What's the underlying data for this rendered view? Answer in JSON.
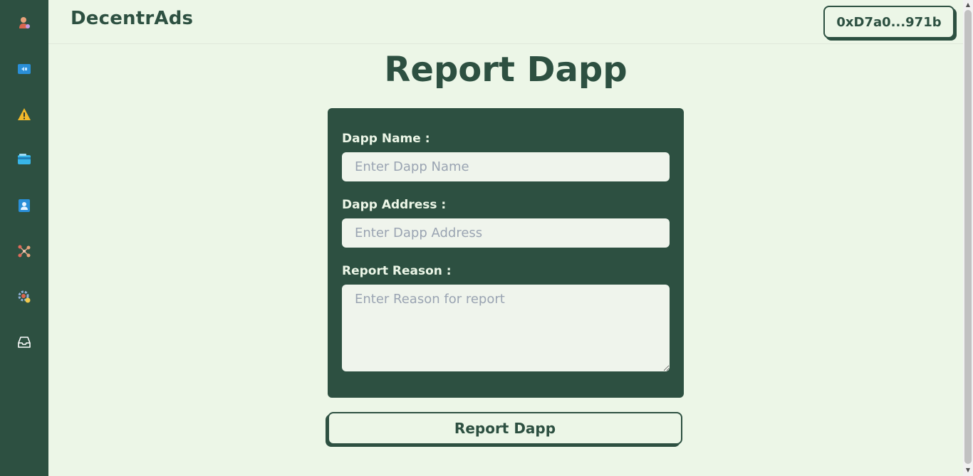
{
  "app": {
    "brand": "DecentrAds"
  },
  "wallet": {
    "address": "0xD7a0...971b"
  },
  "sidebar": {
    "items": [
      {
        "icon": "user-profile-icon"
      },
      {
        "icon": "ad-campaign-icon"
      },
      {
        "icon": "warning-icon"
      },
      {
        "icon": "wallet-card-icon"
      },
      {
        "icon": "contact-icon"
      },
      {
        "icon": "network-nodes-icon"
      },
      {
        "icon": "settings-gear-icon"
      },
      {
        "icon": "inbox-icon"
      }
    ]
  },
  "page": {
    "title": "Report Dapp"
  },
  "form": {
    "dapp_name": {
      "label": "Dapp Name :",
      "placeholder": "Enter Dapp Name",
      "value": ""
    },
    "dapp_address": {
      "label": "Dapp Address :",
      "placeholder": "Enter Dapp Address",
      "value": ""
    },
    "report_reason": {
      "label": "Report Reason :",
      "placeholder": "Enter Reason for report",
      "value": ""
    },
    "submit_label": "Report Dapp"
  },
  "colors": {
    "sidebar_bg": "#2d5041",
    "page_bg": "#ecf6e7",
    "accent": "#2d5041",
    "field_bg": "#eff4ec",
    "placeholder": "#9aa4b2"
  }
}
